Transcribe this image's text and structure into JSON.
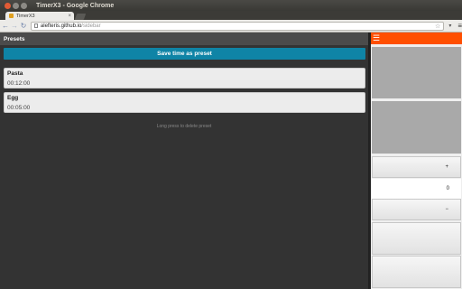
{
  "window": {
    "title": "TimerX3 - Google Chrome"
  },
  "tab": {
    "title": "TimerX3",
    "close": "×"
  },
  "toolbar": {
    "back": "←",
    "forward": "→",
    "reload": "↻",
    "url_host": "alefteris.github.io",
    "url_path": "/sidebar",
    "star": "☆",
    "extension": "▾",
    "menu": "≡"
  },
  "sidebar": {
    "title": "Presets",
    "save_label": "Save time as preset",
    "presets": [
      {
        "name": "Pasta",
        "time": "00:12:00"
      },
      {
        "name": "Egg",
        "time": "00:05:00"
      }
    ],
    "hint": "Long press to delete preset"
  },
  "panel": {
    "menu_icon": "☰",
    "plus": "+",
    "value": "0",
    "minus": "−"
  },
  "colors": {
    "accent": "#ff4f00",
    "save_button": "#0f84a6"
  }
}
